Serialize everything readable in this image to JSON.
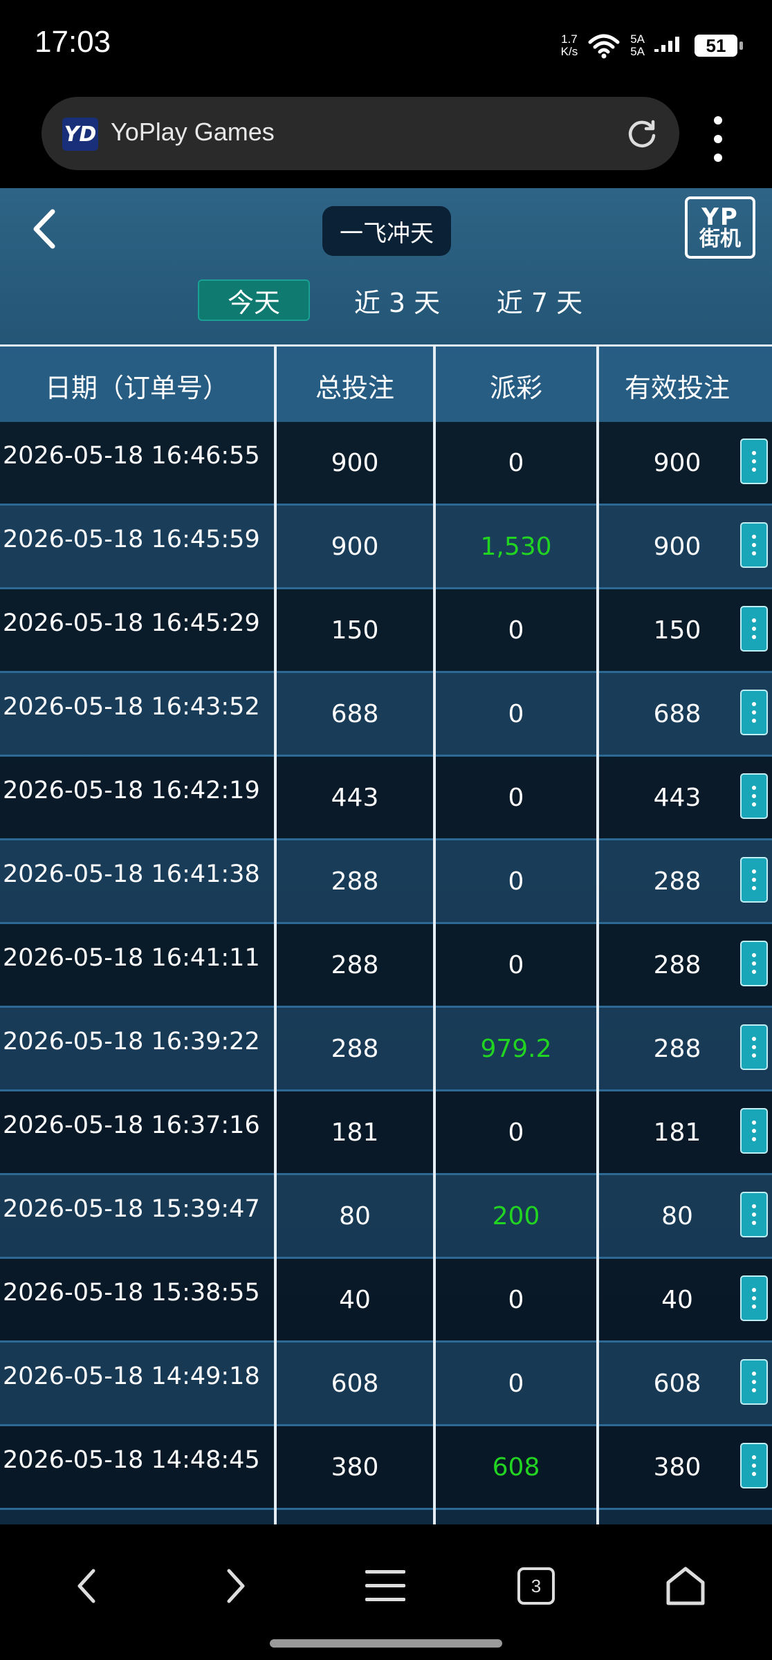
{
  "status_bar": {
    "time": "17:03",
    "net_speed_value": "1.7",
    "net_speed_unit": "K/s",
    "signal_label_1": "5A",
    "signal_label_2": "5A",
    "battery": "51"
  },
  "browser": {
    "logo_text": "YD",
    "site_title": "YoPlay Games",
    "icons": [
      "reload-icon",
      "more-vert-icon"
    ]
  },
  "game": {
    "name": "一飞冲天",
    "brand_top": "YP",
    "brand_bottom": "街机",
    "tabs": [
      {
        "label": "今天",
        "active": true
      },
      {
        "label": "近 3 天",
        "active": false
      },
      {
        "label": "近 7 天",
        "active": false
      }
    ]
  },
  "table": {
    "headers": [
      "日期（订单号）",
      "总投注",
      "派彩",
      "有效投注"
    ],
    "rows": [
      {
        "date": "2026-05-18 16:46:55",
        "bet": "900",
        "payout": "0",
        "valid": "900",
        "win": false
      },
      {
        "date": "2026-05-18 16:45:59",
        "bet": "900",
        "payout": "1,530",
        "valid": "900",
        "win": true
      },
      {
        "date": "2026-05-18 16:45:29",
        "bet": "150",
        "payout": "0",
        "valid": "150",
        "win": false
      },
      {
        "date": "2026-05-18 16:43:52",
        "bet": "688",
        "payout": "0",
        "valid": "688",
        "win": false
      },
      {
        "date": "2026-05-18 16:42:19",
        "bet": "443",
        "payout": "0",
        "valid": "443",
        "win": false
      },
      {
        "date": "2026-05-18 16:41:38",
        "bet": "288",
        "payout": "0",
        "valid": "288",
        "win": false
      },
      {
        "date": "2026-05-18 16:41:11",
        "bet": "288",
        "payout": "0",
        "valid": "288",
        "win": false
      },
      {
        "date": "2026-05-18 16:39:22",
        "bet": "288",
        "payout": "979.2",
        "valid": "288",
        "win": true
      },
      {
        "date": "2026-05-18 16:37:16",
        "bet": "181",
        "payout": "0",
        "valid": "181",
        "win": false
      },
      {
        "date": "2026-05-18 15:39:47",
        "bet": "80",
        "payout": "200",
        "valid": "80",
        "win": true
      },
      {
        "date": "2026-05-18 15:38:55",
        "bet": "40",
        "payout": "0",
        "valid": "40",
        "win": false
      },
      {
        "date": "2026-05-18 14:49:18",
        "bet": "608",
        "payout": "0",
        "valid": "608",
        "win": false
      },
      {
        "date": "2026-05-18 14:48:45",
        "bet": "380",
        "payout": "608",
        "valid": "380",
        "win": true
      }
    ]
  },
  "colors": {
    "win": "#22d422",
    "active_tab": "#0f7a70",
    "more_button": "#19a6b8"
  },
  "bottom_nav": {
    "tab_count": "3",
    "icons": [
      "back-arrow-icon",
      "forward-arrow-icon",
      "menu-icon",
      "tabs-icon",
      "home-icon"
    ]
  }
}
